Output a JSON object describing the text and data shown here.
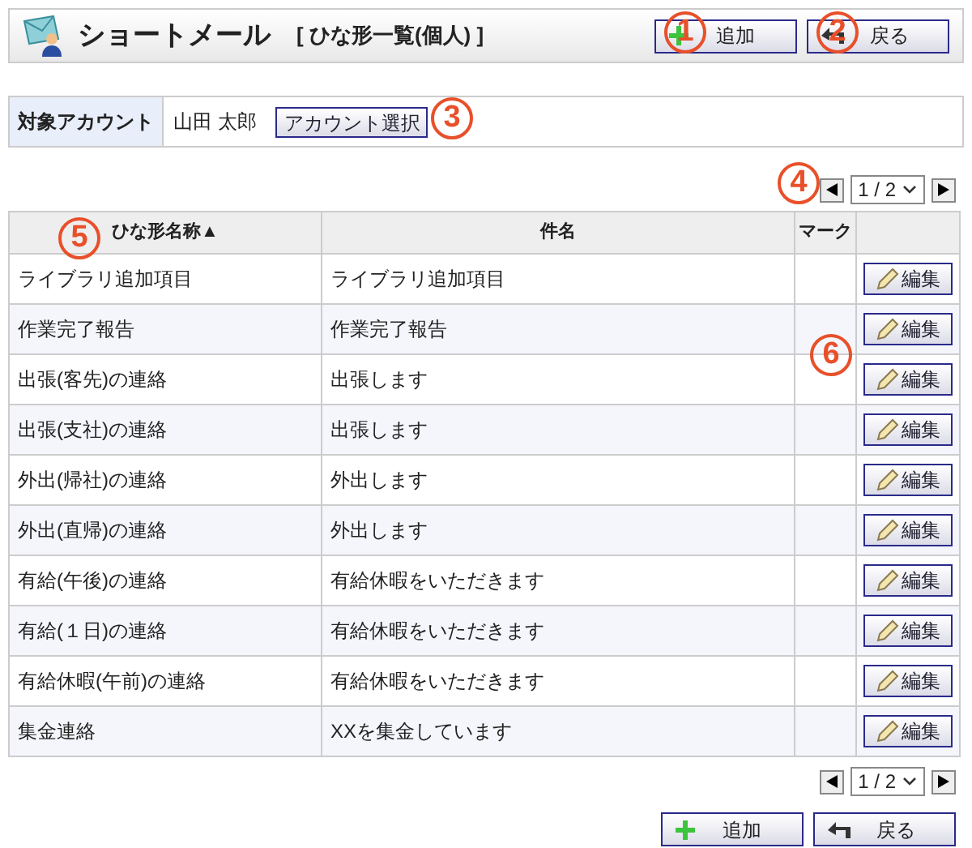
{
  "header": {
    "title": "ショートメール",
    "subtitle": "[ ひな形一覧(個人) ]",
    "buttons": [
      {
        "kind": "add",
        "label": "追加"
      },
      {
        "kind": "back",
        "label": "戻る"
      }
    ]
  },
  "account": {
    "label": "対象アカウント",
    "name": "山田 太郎",
    "button": "アカウント選択"
  },
  "pager_top": {
    "page": "1 / 2"
  },
  "table": {
    "columns": [
      "ひな形名称▲",
      "件名",
      "マーク"
    ],
    "rows": [
      {
        "name": "ライブラリ追加項目",
        "subject": "ライブラリ追加項目",
        "action": "編集"
      },
      {
        "name": "作業完了報告",
        "subject": "作業完了報告",
        "action": "編集"
      },
      {
        "name": "出張(客先)の連絡",
        "subject": "出張します",
        "action": "編集"
      },
      {
        "name": "出張(支社)の連絡",
        "subject": "出張します",
        "action": "編集"
      },
      {
        "name": "外出(帰社)の連絡",
        "subject": "外出します",
        "action": "編集"
      },
      {
        "name": "外出(直帰)の連絡",
        "subject": "外出します",
        "action": "編集"
      },
      {
        "name": "有給(午後)の連絡",
        "subject": "有給休暇をいただきます",
        "action": "編集"
      },
      {
        "name": "有給(１日)の連絡",
        "subject": "有給休暇をいただきます",
        "action": "編集"
      },
      {
        "name": "有給休暇(午前)の連絡",
        "subject": "有給休暇をいただきます",
        "action": "編集"
      },
      {
        "name": "集金連絡",
        "subject": "XXを集金しています",
        "action": "編集"
      }
    ]
  },
  "pager_bottom": {
    "page": "1 / 2"
  },
  "footer_buttons": [
    {
      "kind": "add",
      "label": "追加"
    },
    {
      "kind": "back",
      "label": "戻る"
    }
  ],
  "callouts": [
    "1",
    "2",
    "3",
    "4",
    "5",
    "6"
  ]
}
